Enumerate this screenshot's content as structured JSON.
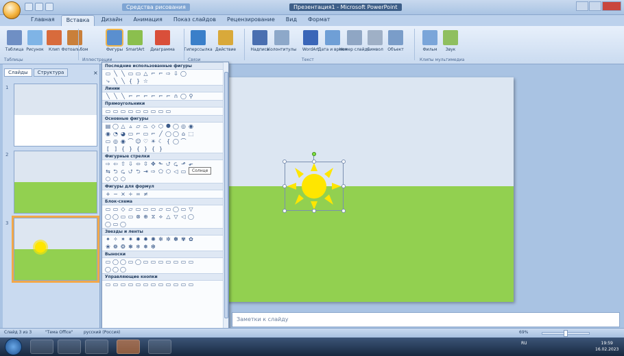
{
  "window": {
    "title": "Презентация1 - Microsoft PowerPoint",
    "tools_title": "Средства рисования"
  },
  "tabs": [
    "Главная",
    "Вставка",
    "Дизайн",
    "Анимация",
    "Показ слайдов",
    "Рецензирование",
    "Вид",
    "Формат"
  ],
  "active_tab_index": 1,
  "ribbon": {
    "buttons": [
      {
        "label": "Таблица",
        "icon": "table-icon"
      },
      {
        "label": "Рисунок",
        "icon": "picture-icon"
      },
      {
        "label": "Клип",
        "icon": "clipart-icon"
      },
      {
        "label": "Фотоальбом",
        "icon": "photo-album-icon"
      },
      {
        "label": "Фигуры",
        "icon": "shapes-icon"
      },
      {
        "label": "SmartArt",
        "icon": "smartart-icon"
      },
      {
        "label": "Диаграмма",
        "icon": "chart-icon"
      },
      {
        "label": "Гиперссылка",
        "icon": "hyperlink-icon"
      },
      {
        "label": "Действие",
        "icon": "action-icon"
      },
      {
        "label": "Надпись",
        "icon": "textbox-icon"
      },
      {
        "label": "Колонтитулы",
        "icon": "header-footer-icon"
      },
      {
        "label": "WordArt",
        "icon": "wordart-icon"
      },
      {
        "label": "Дата и время",
        "icon": "date-time-icon"
      },
      {
        "label": "Номер слайда",
        "icon": "slide-number-icon"
      },
      {
        "label": "Символ",
        "icon": "symbol-icon"
      },
      {
        "label": "Объект",
        "icon": "object-icon"
      },
      {
        "label": "Фильм",
        "icon": "movie-icon"
      },
      {
        "label": "Звук",
        "icon": "sound-icon"
      }
    ],
    "groups": [
      "Таблицы",
      "Иллюстрации",
      "Связи",
      "Текст",
      "Клипы мультимедиа"
    ]
  },
  "left_pane": {
    "tabs": [
      "Слайды",
      "Структура"
    ],
    "close": "×",
    "slides": [
      "1",
      "2",
      "3"
    ]
  },
  "shapes_menu": {
    "sections": [
      {
        "title": "Последние использованные фигуры",
        "rows": [
          "▭╲╲▭▭△⌐⌐⇨⇩◯",
          "⤷╲╲{}☆"
        ]
      },
      {
        "title": "Линии",
        "rows": [
          "╲╲╲⌐⌐⌐⌐⌐⌐∩◯⚲"
        ]
      },
      {
        "title": "Прямоугольники",
        "rows": [
          "▭▭▭▭▭▭▭▭▭"
        ]
      },
      {
        "title": "Основные фигуры",
        "rows": [
          "▤◯△▵▱⏢◇⬡⯃◯◎◉",
          "◉◔◕▭⌐▭⌐╱◯◯⌂⬚",
          "▭◎◉⌒☺♡☀☾{◯⌒",
          "[]{}{}{}"
        ]
      },
      {
        "title": "Фигурные стрелки",
        "rows": [
          "⇨⇦⇧⇩⬄⇳✥⬑⮍⮎⬏⬐",
          "⇆⮌⮎⮍⮌⇥⇨⬠⬡◁▭",
          "⬡⬡⬡"
        ]
      },
      {
        "title": "Фигуры для формул",
        "rows": [
          "+−×÷=≠"
        ]
      },
      {
        "title": "Блок-схема",
        "rows": [
          "▭▭◇▱▭▭▭▱▭◯▭▽",
          "◯◯▭▭⊗⊕⧖⟡△▽◁◯",
          "◯▭◯"
        ]
      },
      {
        "title": "Звезды и ленты",
        "rows": [
          "✦✧✶✷✸✹✺✻✼✽✾✿",
          "❀❁❂❃❄❅❆"
        ]
      },
      {
        "title": "Выноски",
        "rows": [
          "▭◯◯▭◯▭▭▭▭▭▭▭",
          "◯◯◯"
        ]
      },
      {
        "title": "Управляющие кнопки",
        "rows": [
          "▭▭▭▭▭▭▭▭▭▭▭▭"
        ]
      }
    ],
    "tooltip": "Солнце"
  },
  "notes": {
    "placeholder": "Заметки к слайду"
  },
  "status": {
    "slide_info": "Слайд 3 из 3",
    "theme": "\"Тема Office\"",
    "language": "русский (Россия)",
    "zoom": "69%"
  },
  "taskbar": {
    "lang": "RU",
    "time": "19:59",
    "date": "16.02.2023"
  },
  "colors": {
    "sky": "#dce6f2",
    "grass": "#92d050",
    "sun": "#ffe600",
    "accent": "#f2a84a"
  }
}
